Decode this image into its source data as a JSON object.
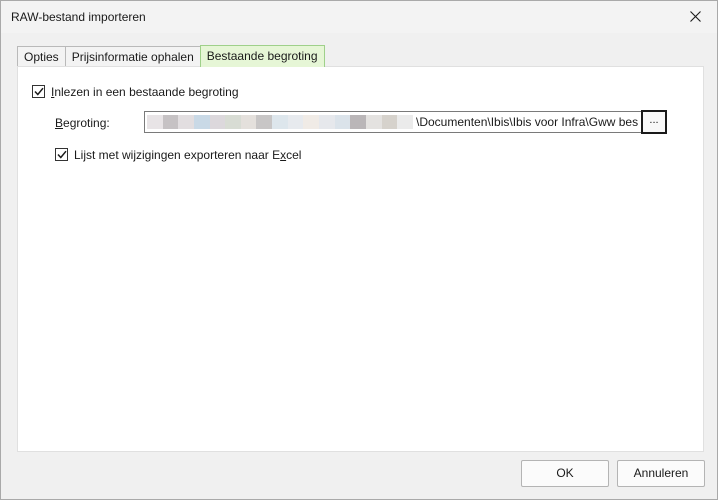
{
  "window": {
    "title": "RAW-bestand importeren"
  },
  "tabs": [
    {
      "label": "Opties"
    },
    {
      "label": "Prijsinformatie ophalen"
    },
    {
      "label": "Bestaande begroting",
      "active": true
    }
  ],
  "options": {
    "read_existing": {
      "prefix": "I",
      "rest": "nlezen in een bestaande begroting",
      "checked": true
    },
    "budget": {
      "label_prefix": "B",
      "label_rest": "egroting:",
      "path_visible": "\\Documenten\\Ibis\\Ibis voor Infra\\Gww bes",
      "browse_label": "..."
    },
    "export_changes": {
      "before": "Lijst met wijzigingen exporteren naar E",
      "accel": "x",
      "after": "cel",
      "checked": true
    }
  },
  "buttons": {
    "ok": "OK",
    "cancel": "Annuleren"
  },
  "colors": {
    "active_tab_bg": "#e6f6d6",
    "panel_bg": "#ffffff",
    "redacted_blocks": [
      "#e8e4e6",
      "#c6c2c4",
      "#e2dee0",
      "#c9d9e6",
      "#dcd8dc",
      "#d8dcd4",
      "#e4e0dc",
      "#c8c6c6",
      "#dde6ec",
      "#e7eaee",
      "#f0ebe6",
      "#e6e8ec",
      "#dbe3ea",
      "#bab6b8",
      "#e4e2e0",
      "#d6d2cc",
      "#ebebeb"
    ]
  }
}
